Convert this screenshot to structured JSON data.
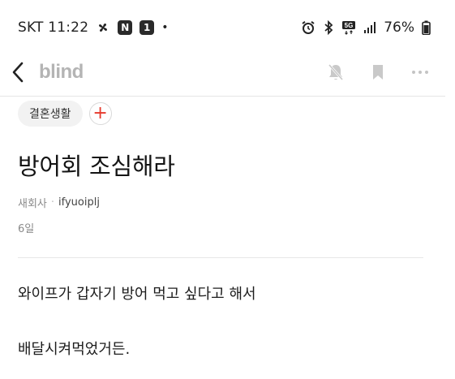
{
  "status_bar": {
    "carrier": "SKT",
    "time": "11:22",
    "left_icons": [
      "pinwheel-icon",
      "n-badge-icon",
      "1-badge-icon"
    ],
    "left_dot": "•",
    "badge_n": "N",
    "badge_1": "1",
    "right_icons": [
      "alarm-icon",
      "bluetooth-icon",
      "5g-icon",
      "signal-icon",
      "battery-icon"
    ],
    "battery": "76%"
  },
  "nav": {
    "brand": "blind",
    "icons": [
      "back-icon",
      "notifications-off-icon",
      "bookmark-icon",
      "more-icon"
    ]
  },
  "topic": {
    "label": "결혼생활",
    "add_label": "+"
  },
  "post": {
    "title": "방어회 조심해라",
    "company": "새회사",
    "separator": "·",
    "author": "ifyuoiplj",
    "date": "6일",
    "lines": [
      "와이프가 갑자기 방어 먹고 싶다고 해서",
      "배달시켜먹었거든."
    ]
  },
  "colors": {
    "accent_red": "#e6392c",
    "brand_gray": "#b4b4b4",
    "chip_bg": "#f2f2f2",
    "divider": "#e6e6e6"
  }
}
